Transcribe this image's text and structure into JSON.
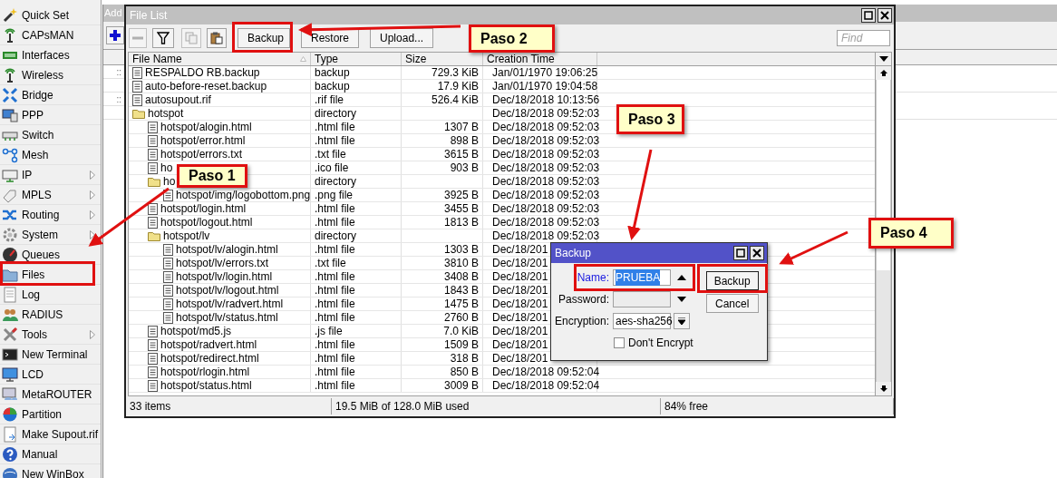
{
  "sidebar": {
    "items": [
      {
        "label": "Quick Set",
        "has_submenu": false
      },
      {
        "label": "CAPsMAN",
        "has_submenu": false
      },
      {
        "label": "Interfaces",
        "has_submenu": false
      },
      {
        "label": "Wireless",
        "has_submenu": false
      },
      {
        "label": "Bridge",
        "has_submenu": false
      },
      {
        "label": "PPP",
        "has_submenu": false
      },
      {
        "label": "Switch",
        "has_submenu": false
      },
      {
        "label": "Mesh",
        "has_submenu": false
      },
      {
        "label": "IP",
        "has_submenu": true
      },
      {
        "label": "MPLS",
        "has_submenu": true
      },
      {
        "label": "Routing",
        "has_submenu": true
      },
      {
        "label": "System",
        "has_submenu": true
      },
      {
        "label": "Queues",
        "has_submenu": false
      },
      {
        "label": "Files",
        "has_submenu": false
      },
      {
        "label": "Log",
        "has_submenu": false
      },
      {
        "label": "RADIUS",
        "has_submenu": false
      },
      {
        "label": "Tools",
        "has_submenu": true
      },
      {
        "label": "New Terminal",
        "has_submenu": false
      },
      {
        "label": "LCD",
        "has_submenu": false
      },
      {
        "label": "MetaROUTER",
        "has_submenu": false
      },
      {
        "label": "Partition",
        "has_submenu": false
      },
      {
        "label": "Make Supout.rif",
        "has_submenu": false
      },
      {
        "label": "Manual",
        "has_submenu": false
      },
      {
        "label": "New WinBox",
        "has_submenu": false
      }
    ]
  },
  "background_window": {
    "title": "Add",
    "row_marks": [
      "::",
      "::"
    ]
  },
  "file_list": {
    "title": "File List",
    "toolbar": {
      "buttons": [
        "Backup",
        "Restore",
        "Upload..."
      ],
      "search": {
        "placeholder": "Find"
      }
    },
    "columns": [
      "File Name",
      "Type",
      "Size",
      "Creation Time"
    ],
    "rows": [
      {
        "kind": "file",
        "name": "RESPALDO RB.backup",
        "type": "backup",
        "size": "729.3 KiB",
        "created": "Jan/01/1970 19:06:25"
      },
      {
        "kind": "file",
        "name": "auto-before-reset.backup",
        "type": "backup",
        "size": "17.9 KiB",
        "created": "Jan/01/1970 19:04:58"
      },
      {
        "kind": "file",
        "name": "autosupout.rif",
        "type": ".rif file",
        "size": "526.4 KiB",
        "created": "Dec/18/2018 10:13:56"
      },
      {
        "kind": "folder",
        "name": "hotspot",
        "type": "directory",
        "created": "Dec/18/2018 09:52:03",
        "children": [
          {
            "kind": "file",
            "name": "hotspot/alogin.html",
            "type": ".html file",
            "size": "1307 B",
            "created": "Dec/18/2018 09:52:03"
          },
          {
            "kind": "file",
            "name": "hotspot/error.html",
            "type": ".html file",
            "size": "898 B",
            "created": "Dec/18/2018 09:52:03"
          },
          {
            "kind": "file",
            "name": "hotspot/errors.txt",
            "type": ".txt file",
            "size": "3615 B",
            "created": "Dec/18/2018 09:52:03"
          },
          {
            "kind": "file",
            "name": "ho",
            "type": ".ico file",
            "size": "903 B",
            "created": "Dec/18/2018 09:52:03"
          },
          {
            "kind": "folder",
            "name": "ho",
            "type": "directory",
            "created": "Dec/18/2018 09:52:03",
            "children": [
              {
                "kind": "file",
                "name": "hotspot/img/logobottom.png",
                "type": ".png file",
                "size": "3925 B",
                "created": "Dec/18/2018 09:52:03"
              }
            ]
          },
          {
            "kind": "file",
            "name": "hotspot/login.html",
            "type": ".html file",
            "size": "3455 B",
            "created": "Dec/18/2018 09:52:03"
          },
          {
            "kind": "file",
            "name": "hotspot/logout.html",
            "type": ".html file",
            "size": "1813 B",
            "created": "Dec/18/2018 09:52:03"
          },
          {
            "kind": "folder",
            "name": "hotspot/lv",
            "type": "directory",
            "created": "Dec/18/2018 09:52:03",
            "children": [
              {
                "kind": "file",
                "name": "hotspot/lv/alogin.html",
                "type": ".html file",
                "size": "1303 B",
                "created": "Dec/18/201"
              },
              {
                "kind": "file",
                "name": "hotspot/lv/errors.txt",
                "type": ".txt file",
                "size": "3810 B",
                "created": "Dec/18/201"
              },
              {
                "kind": "file",
                "name": "hotspot/lv/login.html",
                "type": ".html file",
                "size": "3408 B",
                "created": "Dec/18/201"
              },
              {
                "kind": "file",
                "name": "hotspot/lv/logout.html",
                "type": ".html file",
                "size": "1843 B",
                "created": "Dec/18/201"
              },
              {
                "kind": "file",
                "name": "hotspot/lv/radvert.html",
                "type": ".html file",
                "size": "1475 B",
                "created": "Dec/18/201"
              },
              {
                "kind": "file",
                "name": "hotspot/lv/status.html",
                "type": ".html file",
                "size": "2760 B",
                "created": "Dec/18/201"
              }
            ]
          },
          {
            "kind": "file",
            "name": "hotspot/md5.js",
            "type": ".js file",
            "size": "7.0 KiB",
            "created": "Dec/18/201"
          },
          {
            "kind": "file",
            "name": "hotspot/radvert.html",
            "type": ".html file",
            "size": "1509 B",
            "created": "Dec/18/201"
          },
          {
            "kind": "file",
            "name": "hotspot/redirect.html",
            "type": ".html file",
            "size": "318 B",
            "created": "Dec/18/201"
          },
          {
            "kind": "file",
            "name": "hotspot/rlogin.html",
            "type": ".html file",
            "size": "850 B",
            "created": "Dec/18/2018 09:52:04"
          },
          {
            "kind": "file",
            "name": "hotspot/status.html",
            "type": ".html file",
            "size": "3009 B",
            "created": "Dec/18/2018 09:52:04"
          }
        ]
      }
    ],
    "status_bar": [
      "33 items",
      "19.5 MiB of 128.0 MiB used",
      "84% free"
    ]
  },
  "backup_dialog": {
    "title": "Backup",
    "fields": [
      {
        "kind": "text",
        "label": "Name:",
        "value": "PRUEBA",
        "focused": true,
        "disabled": false
      },
      {
        "kind": "text",
        "label": "Password:",
        "focused": false,
        "disabled": true
      },
      {
        "kind": "select",
        "label": "Encryption:",
        "value": "aes-sha256",
        "focused": false,
        "disabled": false
      }
    ],
    "checkbox": {
      "label": "Don't Encrypt",
      "checked": false
    },
    "buttons": [
      "Backup",
      "Cancel"
    ]
  },
  "callouts": [
    "Paso 1",
    "Paso 2",
    "Paso 3",
    "Paso 4"
  ]
}
